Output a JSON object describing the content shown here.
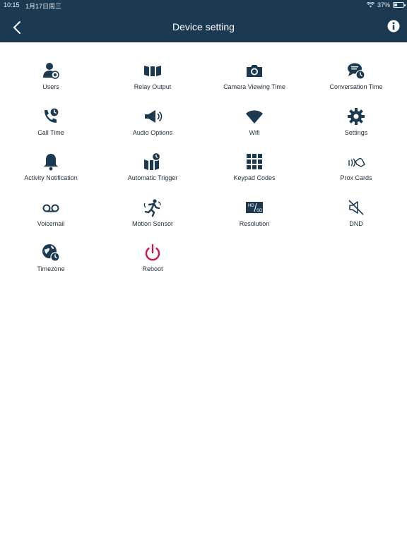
{
  "status": {
    "time": "10:15",
    "date": "1月17日周三",
    "battery": "37%",
    "battery_level": 0.37
  },
  "header": {
    "title": "Device setting"
  },
  "colors": {
    "header_bg": "#1b3a52",
    "icon": "#1b3a52",
    "reboot_icon": "#c8174a"
  },
  "items": [
    {
      "label": "Users",
      "icon": "users-icon"
    },
    {
      "label": "Relay Output",
      "icon": "relay-icon"
    },
    {
      "label": "Camera Viewing Time",
      "icon": "camera-icon"
    },
    {
      "label": "Conversation Time",
      "icon": "chat-clock-icon"
    },
    {
      "label": "Call Time",
      "icon": "phone-clock-icon"
    },
    {
      "label": "Audio Options",
      "icon": "speaker-icon"
    },
    {
      "label": "Wifi",
      "icon": "wifi-icon"
    },
    {
      "label": "Settings",
      "icon": "gear-icon"
    },
    {
      "label": "Activity Notification",
      "icon": "bell-icon"
    },
    {
      "label": "Automatic Trigger",
      "icon": "trigger-icon"
    },
    {
      "label": "Keypad Codes",
      "icon": "keypad-icon"
    },
    {
      "label": "Prox Cards",
      "icon": "nfc-icon"
    },
    {
      "label": "Voicemail",
      "icon": "voicemail-icon"
    },
    {
      "label": "Motion Sensor",
      "icon": "motion-icon"
    },
    {
      "label": "Resolution",
      "icon": "hd-sd-icon"
    },
    {
      "label": "DND",
      "icon": "mute-icon"
    },
    {
      "label": "Timezone",
      "icon": "globe-clock-icon"
    },
    {
      "label": "Reboot",
      "icon": "power-icon"
    }
  ]
}
